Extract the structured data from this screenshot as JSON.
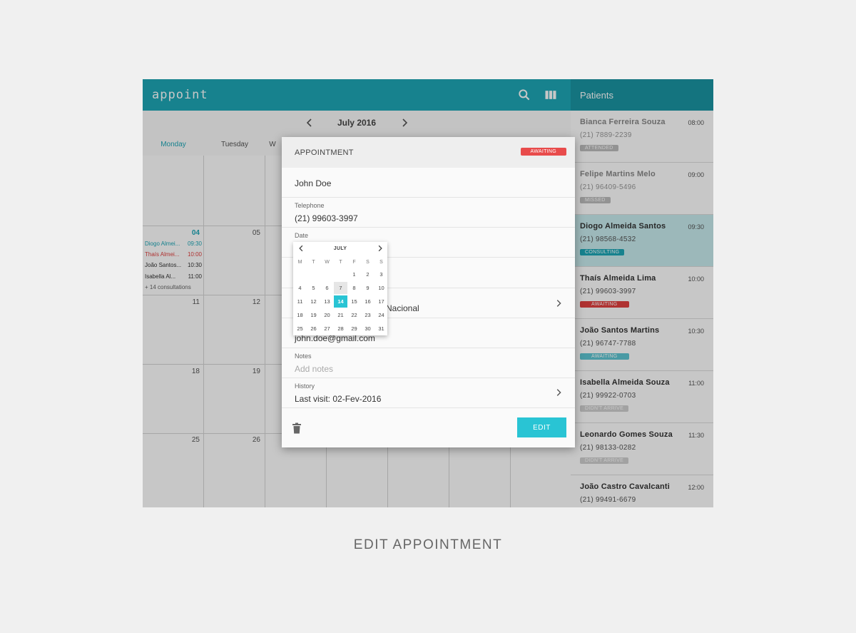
{
  "app": {
    "logo": "appoint"
  },
  "calendar": {
    "month_label": "July 2016",
    "weekdays": [
      "Monday",
      "Tuesday",
      "W"
    ],
    "days": [
      "04",
      "05",
      "11",
      "12",
      "18",
      "19",
      "25",
      "26"
    ],
    "events": [
      {
        "name": "Diogo Almei...",
        "time": "09:30"
      },
      {
        "name": "Thaís Almei...",
        "time": "10:00"
      },
      {
        "name": "João Santos...",
        "time": "10:30"
      },
      {
        "name": "Isabella Al...",
        "time": "11:00"
      }
    ],
    "more": "+ 14 consultations"
  },
  "sidebar": {
    "title": "Patients",
    "patients": [
      {
        "name": "Bianca Ferreira Souza",
        "time": "08:00",
        "phone": "(21) 7889-2239",
        "status": "ATTENDED"
      },
      {
        "name": "Felipe Martins Melo",
        "time": "09:00",
        "phone": "(21) 96409-5496",
        "status": "MISSED"
      },
      {
        "name": "Diogo Almeida Santos",
        "time": "09:30",
        "phone": "(21) 98568-4532",
        "status": "CONSULTING"
      },
      {
        "name": "Thaís Almeida Lima",
        "time": "10:00",
        "phone": "(21) 99603-3997",
        "status": "AWAITING"
      },
      {
        "name": "João Santos Martins",
        "time": "10:30",
        "phone": "(21) 96747-7788",
        "status": "AWAITING"
      },
      {
        "name": "Isabella Almeida Souza",
        "time": "11:00",
        "phone": "(21) 99922-0703",
        "status": "DIDN'T ARRIVE"
      },
      {
        "name": "Leonardo Gomes Souza",
        "time": "11:30",
        "phone": "(21) 98133-0282",
        "status": "DIDN'T ARRIVE"
      },
      {
        "name": "João Castro Cavalcanti",
        "time": "12:00",
        "phone": "(21) 99491-6679",
        "status": ""
      }
    ]
  },
  "dialog": {
    "title": "APPOINTMENT",
    "status": "AWAITING",
    "name": "John Doe",
    "telephone_label": "Telephone",
    "telephone": "(21) 99603-3997",
    "date_label": "Date",
    "insurance_partial": "Nacional",
    "email": "john.doe@gmail.com",
    "notes_label": "Notes",
    "notes_placeholder": "Add notes",
    "history_label": "History",
    "history_value": "Last visit: 02-Fev-2016",
    "edit_label": "EDIT"
  },
  "datepicker": {
    "month": "JULY",
    "dow": [
      "M",
      "T",
      "W",
      "T",
      "F",
      "S",
      "S"
    ],
    "weeks": [
      [
        "",
        "",
        "",
        "",
        "1",
        "2",
        "3"
      ],
      [
        "4",
        "5",
        "6",
        "7",
        "8",
        "9",
        "10"
      ],
      [
        "11",
        "12",
        "13",
        "14",
        "15",
        "16",
        "17"
      ],
      [
        "18",
        "19",
        "20",
        "21",
        "22",
        "23",
        "24"
      ],
      [
        "25",
        "26",
        "27",
        "28",
        "29",
        "30",
        "31"
      ]
    ],
    "selected": "14",
    "previous": "7"
  },
  "caption": "EDIT APPOINTMENT",
  "colors": {
    "primary": "#1ea7b7",
    "accent": "#29c4d4",
    "danger": "#e84b4b"
  }
}
